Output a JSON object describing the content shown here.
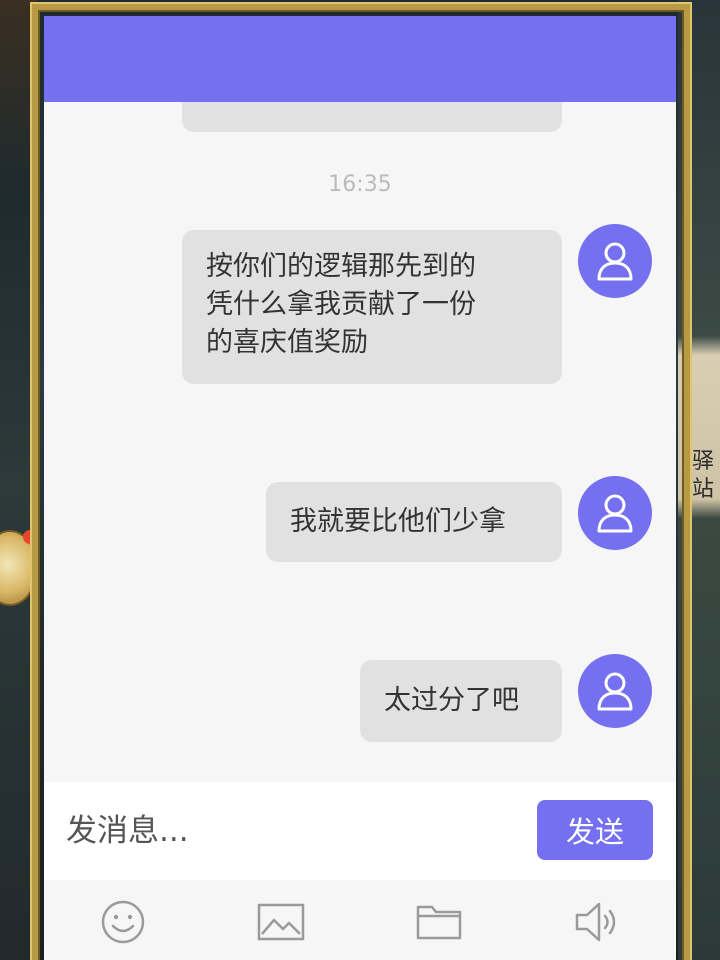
{
  "chat": {
    "timestamp": "16:35",
    "messages": [
      {
        "text": "按你们的逻辑那先到的\n凭什么拿我贡献了一份\n的喜庆值奖励"
      },
      {
        "text": "我就要比他们少拿"
      },
      {
        "text": "太过分了吧"
      }
    ]
  },
  "input": {
    "placeholder": "发消息...",
    "send_label": "发送"
  },
  "toolbar": {
    "icons": [
      "emoji-icon",
      "image-icon",
      "folder-icon",
      "speaker-icon"
    ]
  },
  "background": {
    "side_text": "驿\n站"
  },
  "colors": {
    "accent": "#7470f0",
    "bubble": "#e1e1e1",
    "panel": "#f6f6f6"
  }
}
